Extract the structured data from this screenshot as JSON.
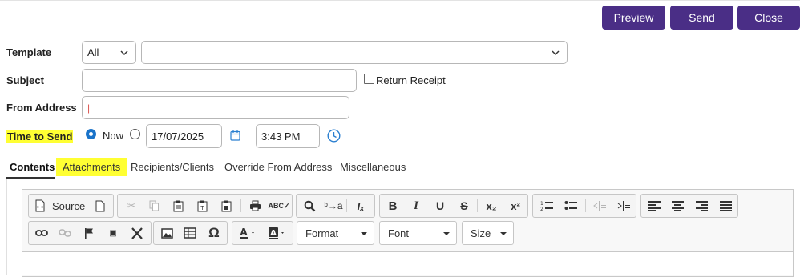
{
  "header": {
    "preview_label": "Preview",
    "send_label": "Send",
    "close_label": "Close"
  },
  "form": {
    "template_label": "Template",
    "template_filter_value": "All",
    "template_value": "",
    "subject_label": "Subject",
    "subject_value": "",
    "return_receipt_label": "Return Receipt",
    "from_address_label": "From Address",
    "from_address_value": "|",
    "time_to_send_label": "Time to Send",
    "now_label": "Now",
    "date_value": "17/07/2025",
    "time_value": "3:43 PM"
  },
  "tabs": [
    {
      "label": "Contents"
    },
    {
      "label": "Attachments"
    },
    {
      "label": "Recipients/Clients"
    },
    {
      "label": "Override From Address"
    },
    {
      "label": "Miscellaneous"
    }
  ],
  "toolbar": {
    "source_label": "Source",
    "format_label": "Format",
    "font_label": "Font",
    "size_label": "Size"
  },
  "colors": {
    "accent": "#4a2e86",
    "highlight": "#ffff33",
    "radio_selected": "#1a73c9"
  }
}
